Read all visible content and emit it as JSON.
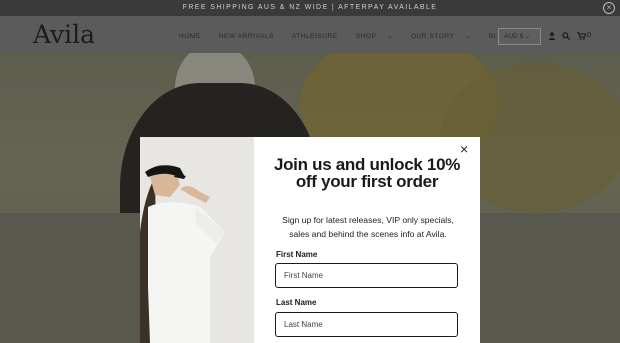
{
  "announcement": {
    "text": "FREE SHIPPING AUS & NZ WIDE | AFTERPAY AVAILABLE",
    "close_glyph": "×"
  },
  "header": {
    "logo": "Avila",
    "nav": [
      {
        "label": "HOME",
        "caret": ""
      },
      {
        "label": "NEW ARRIVALS",
        "caret": ""
      },
      {
        "label": "ATHLEISURE",
        "caret": ""
      },
      {
        "label": "SHOP",
        "caret": "⌄"
      },
      {
        "label": "OUR STORY",
        "caret": "⌄"
      },
      {
        "label": "BLOG",
        "caret": ""
      }
    ],
    "currency": "AUD $ ⌄",
    "cart_count": "0",
    "icons": {
      "account": "user-icon",
      "search": "search-icon",
      "cart": "cart-icon"
    }
  },
  "popup": {
    "title": "Join us and unlock 10% off your first order",
    "subtitle": "Sign up for latest releases, VIP only specials, sales and behind the scenes info at Avila.",
    "first_name_label": "First Name",
    "first_name_placeholder": "First Name",
    "last_name_label": "Last Name",
    "last_name_placeholder": "Last Name",
    "close_glyph": "×"
  }
}
